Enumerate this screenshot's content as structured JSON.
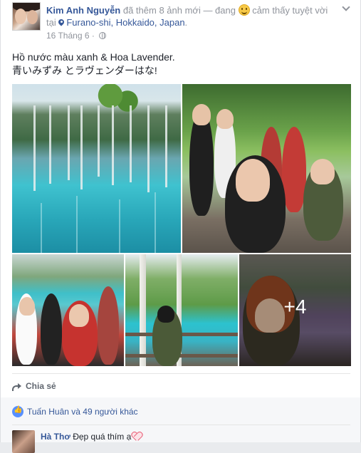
{
  "post": {
    "author": "Kim Anh Nguyễn",
    "action_text": " đã thêm 8 ảnh mới — đang ",
    "feeling_text": " cảm thấy tuyệt vời tại ",
    "location": "Furano-shi, Hokkaido, Japan",
    "location_suffix": ".",
    "date": "16 Tháng 6",
    "meta_separator": " · ",
    "text_line1": "Hồ nước màu xanh & Hoa Lavender.",
    "text_line2": "青いみずみ とラヴェンダーはな!",
    "more_photos": "+4"
  },
  "actions": {
    "share_label": "Chia sẻ"
  },
  "likes": {
    "text": "Tuấn Huân và 49 người khác"
  },
  "comment": {
    "author": "Hà Thơ",
    "text": " Đẹp quá thím ạ"
  },
  "icons": [
    "chevron-down-icon",
    "feeling-happy-icon",
    "location-pin-icon",
    "globe-icon",
    "share-icon",
    "like-icon",
    "heart-icon"
  ],
  "colors": {
    "link": "#365899",
    "meta": "#90949c",
    "like": "#5890ff"
  }
}
